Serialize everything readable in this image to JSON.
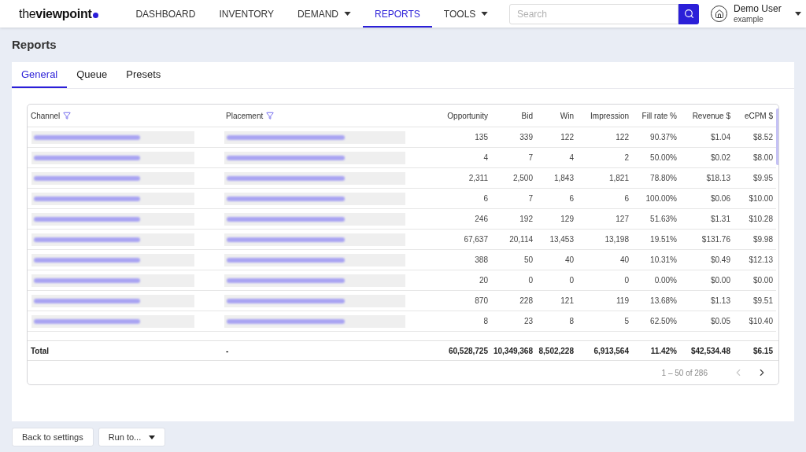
{
  "header": {
    "logo": "the**viewpoint**",
    "nav": [
      {
        "label": "DASHBOARD",
        "selected": false,
        "dropdown": false
      },
      {
        "label": "INVENTORY",
        "selected": false,
        "dropdown": false
      },
      {
        "label": "DEMAND",
        "selected": false,
        "dropdown": true
      },
      {
        "label": "REPORTS",
        "selected": true,
        "dropdown": false
      },
      {
        "label": "TOOLS",
        "selected": false,
        "dropdown": true
      }
    ],
    "search": {
      "placeholder": "Search"
    },
    "user": {
      "name": "Demo User",
      "account": "example"
    }
  },
  "page": {
    "title": "Reports"
  },
  "tabs": [
    {
      "label": "General",
      "selected": true
    },
    {
      "label": "Queue",
      "selected": false
    },
    {
      "label": "Presets",
      "selected": false
    }
  ],
  "table": {
    "columns": [
      {
        "label": "Channel",
        "kind": "dimension",
        "filter": true
      },
      {
        "label": "Placement",
        "kind": "dimension",
        "filter": true
      },
      {
        "label": "Opportunity",
        "kind": "metric",
        "filter": false
      },
      {
        "label": "Bid",
        "kind": "metric",
        "filter": false
      },
      {
        "label": "Win",
        "kind": "metric",
        "filter": false
      },
      {
        "label": "Impression",
        "kind": "metric",
        "filter": false
      },
      {
        "label": "Fill rate %",
        "kind": "metric",
        "filter": false
      },
      {
        "label": "Revenue $",
        "kind": "metric",
        "filter": false
      },
      {
        "label": "eCPM $",
        "kind": "metric",
        "filter": false
      }
    ],
    "rows": [
      {
        "values": [
          "135",
          "339",
          "122",
          "122",
          "90.37%",
          "$1.04",
          "$8.52"
        ]
      },
      {
        "values": [
          "4",
          "7",
          "4",
          "2",
          "50.00%",
          "$0.02",
          "$8.00"
        ]
      },
      {
        "values": [
          "2,311",
          "2,500",
          "1,843",
          "1,821",
          "78.80%",
          "$18.13",
          "$9.95"
        ]
      },
      {
        "values": [
          "6",
          "7",
          "6",
          "6",
          "100.00%",
          "$0.06",
          "$10.00"
        ]
      },
      {
        "values": [
          "246",
          "192",
          "129",
          "127",
          "51.63%",
          "$1.31",
          "$10.28"
        ]
      },
      {
        "values": [
          "67,637",
          "20,114",
          "13,453",
          "13,198",
          "19.51%",
          "$131.76",
          "$9.98"
        ]
      },
      {
        "values": [
          "388",
          "50",
          "40",
          "40",
          "10.31%",
          "$0.49",
          "$12.13"
        ]
      },
      {
        "values": [
          "20",
          "0",
          "0",
          "0",
          "0.00%",
          "$0.00",
          "$0.00"
        ]
      },
      {
        "values": [
          "870",
          "228",
          "121",
          "119",
          "13.68%",
          "$1.13",
          "$9.51"
        ]
      },
      {
        "values": [
          "8",
          "23",
          "8",
          "5",
          "62.50%",
          "$0.05",
          "$10.40"
        ]
      }
    ],
    "total": {
      "cells": [
        "Total",
        "-",
        "60,528,725",
        "10,349,368",
        "8,502,228",
        "6,913,564",
        "11.42%",
        "$42,534.48",
        "$6.15"
      ]
    },
    "pagination": {
      "range": "1 – 50 of 286",
      "prev_disabled": true,
      "next_disabled": false
    }
  },
  "actions": [
    {
      "label": "Back to settings",
      "dropdown": false
    },
    {
      "label": "Run to...",
      "dropdown": true
    }
  ]
}
